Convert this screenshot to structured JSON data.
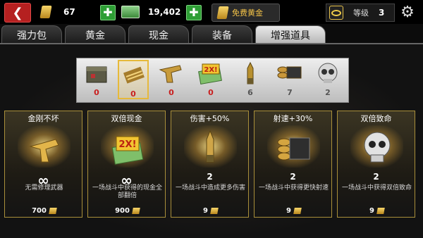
{
  "topbar": {
    "back_glyph": "❮",
    "gold_value": "67",
    "cash_value": "19,402",
    "free_gold_label": "免费黄金",
    "level_label": "等级",
    "level_value": "3",
    "settings_glyph": "⚙",
    "plus_glyph": "✚"
  },
  "tabs": [
    {
      "label": "强力包"
    },
    {
      "label": "黄金"
    },
    {
      "label": "现金"
    },
    {
      "label": "装备"
    },
    {
      "label": "增强道具",
      "active": true
    }
  ],
  "strip": [
    {
      "icon": "ammo-box-icon",
      "count": "0"
    },
    {
      "icon": "bullets-icon",
      "count": "0",
      "selected": true
    },
    {
      "icon": "pistol-icon",
      "count": "0"
    },
    {
      "icon": "double-cash-icon",
      "count": "0"
    },
    {
      "icon": "sniper-bullet-icon",
      "count": "6"
    },
    {
      "icon": "bullet-rounds-icon",
      "count": "7"
    },
    {
      "icon": "skull-icon",
      "count": "2"
    }
  ],
  "cards": [
    {
      "title": "金刚不坏",
      "value": "∞",
      "desc": "无需修理武器",
      "price": "700",
      "icon": "gold-pistol-icon"
    },
    {
      "title": "双倍现金",
      "value": "∞",
      "desc": "一场战斗中获得的现金全部翻倍",
      "price": "900",
      "icon": "double-cash-icon"
    },
    {
      "title": "伤害+50%",
      "value": "2",
      "desc": "一场战斗中造成更多伤害",
      "price": "9",
      "icon": "bullet-icon"
    },
    {
      "title": "射速+30%",
      "value": "2",
      "desc": "一场战斗中获得更快射速",
      "price": "9",
      "icon": "bullet-rounds-icon"
    },
    {
      "title": "双倍致命",
      "value": "2",
      "desc": "一场战斗中获得双倍致命",
      "price": "9",
      "icon": "skull-icon"
    }
  ],
  "double_badge": "2X!"
}
